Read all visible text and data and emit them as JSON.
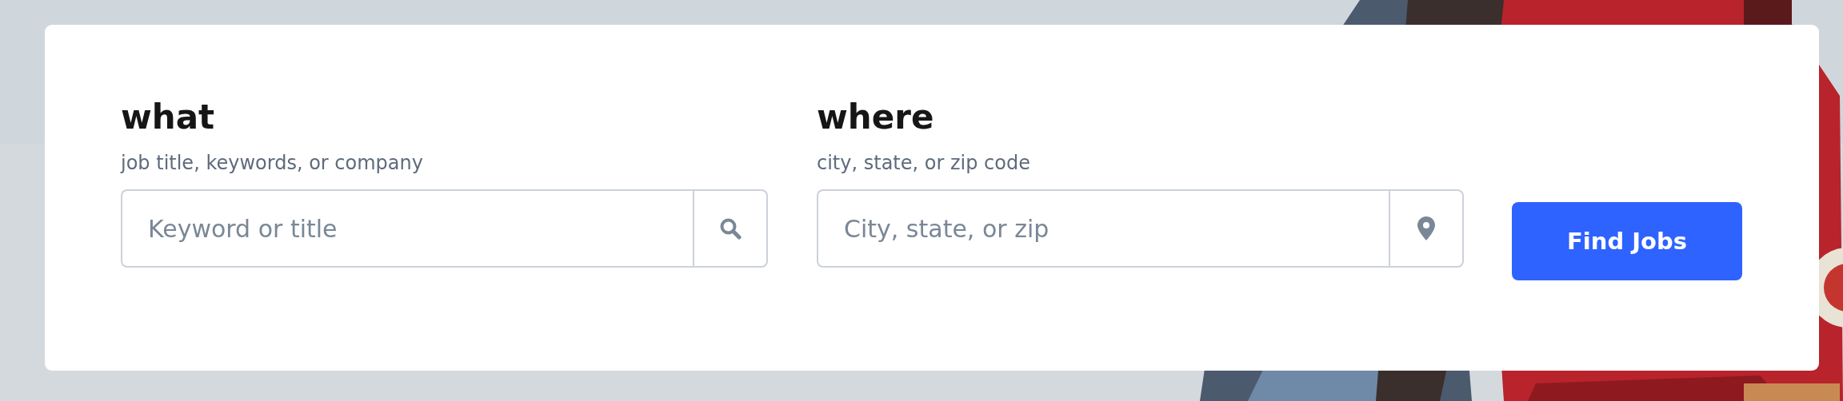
{
  "search_fields": [
    {
      "kind": "keyword",
      "label": "what",
      "hint": "job title, keywords, or company",
      "placeholder": "Keyword or title"
    },
    {
      "kind": "location",
      "label": "where",
      "hint": "city, state, or zip code",
      "placeholder": "City, state, or zip"
    }
  ],
  "submit_button": {
    "label": "Find Jobs"
  }
}
